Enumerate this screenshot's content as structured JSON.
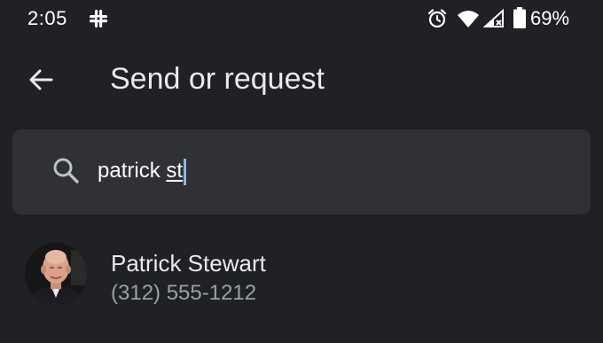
{
  "status_bar": {
    "time": "2:05",
    "battery": "69%",
    "icons": [
      "slack-icon",
      "alarm-icon",
      "wifi-icon",
      "cellular-signal-icon",
      "battery-icon"
    ]
  },
  "app_bar": {
    "back_icon": "arrow-back-icon",
    "title": "Send or request"
  },
  "search": {
    "icon": "search-icon",
    "value_prefix": "patrick ",
    "value_composing": "st"
  },
  "results": [
    {
      "name": "Patrick Stewart",
      "phone": "(312) 555-1212",
      "avatar": "contact-photo"
    }
  ],
  "colors": {
    "background": "#202124",
    "search_field": "#303134",
    "primary_text": "#e8eaed",
    "secondary_text": "#9aa0a6",
    "caret": "#8ab4f8"
  }
}
